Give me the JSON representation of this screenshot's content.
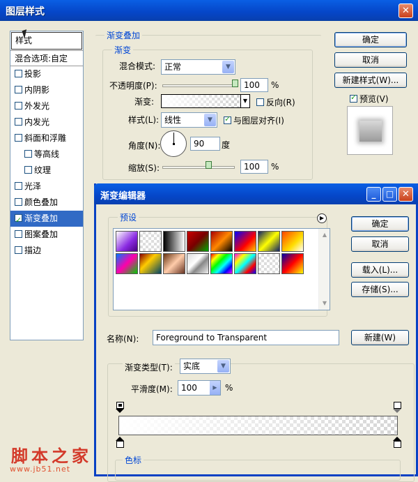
{
  "layer_style": {
    "title": "图层样式",
    "styles_header": "样式",
    "blend_options": "混合选项:自定",
    "items": [
      {
        "label": "投影",
        "checked": false,
        "sub": false
      },
      {
        "label": "内阴影",
        "checked": false,
        "sub": false
      },
      {
        "label": "外发光",
        "checked": false,
        "sub": false
      },
      {
        "label": "内发光",
        "checked": false,
        "sub": false
      },
      {
        "label": "斜面和浮雕",
        "checked": false,
        "sub": false
      },
      {
        "label": "等高线",
        "checked": false,
        "sub": true
      },
      {
        "label": "纹理",
        "checked": false,
        "sub": true
      },
      {
        "label": "光泽",
        "checked": false,
        "sub": false
      },
      {
        "label": "颜色叠加",
        "checked": false,
        "sub": false
      },
      {
        "label": "渐变叠加",
        "checked": true,
        "sub": false,
        "selected": true
      },
      {
        "label": "图案叠加",
        "checked": false,
        "sub": false
      },
      {
        "label": "描边",
        "checked": false,
        "sub": false
      }
    ],
    "section_title": "渐变叠加",
    "group_title": "渐变",
    "blend_mode_label": "混合模式:",
    "blend_mode_value": "正常",
    "opacity_label": "不透明度(P):",
    "opacity_value": "100",
    "opacity_unit": "%",
    "gradient_label": "渐变:",
    "reverse_label": "反向(R)",
    "reverse_checked": false,
    "style_label": "样式(L):",
    "style_value": "线性",
    "align_label": "与图层对齐(I)",
    "align_checked": true,
    "angle_label": "角度(N):",
    "angle_value": "90",
    "angle_unit": "度",
    "scale_label": "缩放(S):",
    "scale_value": "100",
    "scale_unit": "%",
    "ok_button": "确定",
    "cancel_button": "取消",
    "new_style_button": "新建样式(W)...",
    "preview_label": "预览(V)",
    "preview_checked": true,
    "close_icon_glyph": "✕"
  },
  "gradient_editor": {
    "title": "渐变编辑器",
    "presets_label": "预设",
    "ok_button": "确定",
    "cancel_button": "取消",
    "load_button": "载入(L)...",
    "save_button": "存储(S)...",
    "name_label": "名称(N):",
    "name_value": "Foreground to Transparent",
    "new_button": "新建(W)",
    "type_label": "渐变类型(T):",
    "type_value": "实底",
    "smoothness_label": "平滑度(M):",
    "smoothness_value": "100",
    "smoothness_unit": "%",
    "color_stops_label": "色标",
    "presets": [
      "linear-gradient(135deg,#fff,#8a2be2 60%,#4b0082)",
      "repeating-conic-gradient(#ddd 0% 25%,#fff 0% 50%) 0 0/8px 8px",
      "linear-gradient(to right,#000,#fff)",
      "linear-gradient(135deg,#c00,#700 50%,#0a0)",
      "linear-gradient(135deg,#a00,#f80 50%,#000)",
      "linear-gradient(135deg,#00f,#f00 60%,#fc0)",
      "linear-gradient(135deg,#126,#ff0 50%,#126)",
      "linear-gradient(135deg,#f40,#fd0 60%,#fff)",
      "linear-gradient(135deg,#07f,#f0a 50%,#0c0)",
      "linear-gradient(135deg,#800,#fc0 40%,#046)",
      "linear-gradient(135deg,#631,#fca 50%,#632)",
      "linear-gradient(135deg,#ddd,#fff 40%,#888 60%,#eee)",
      "linear-gradient(135deg,#f00,#ff0,#0f0,#0ff,#00f,#f0f)",
      "linear-gradient(135deg,#f0f,#ff0 25%,#0ff 50%,#f00 75%,#00f)",
      "repeating-conic-gradient(#ddd 0% 25%,#fff 0% 50%) 0 0/8px 8px",
      "linear-gradient(135deg,#00a,#f00 50%,#ff0)"
    ]
  },
  "watermark": {
    "text": "脚本之家",
    "url": "www.jb51.net"
  }
}
